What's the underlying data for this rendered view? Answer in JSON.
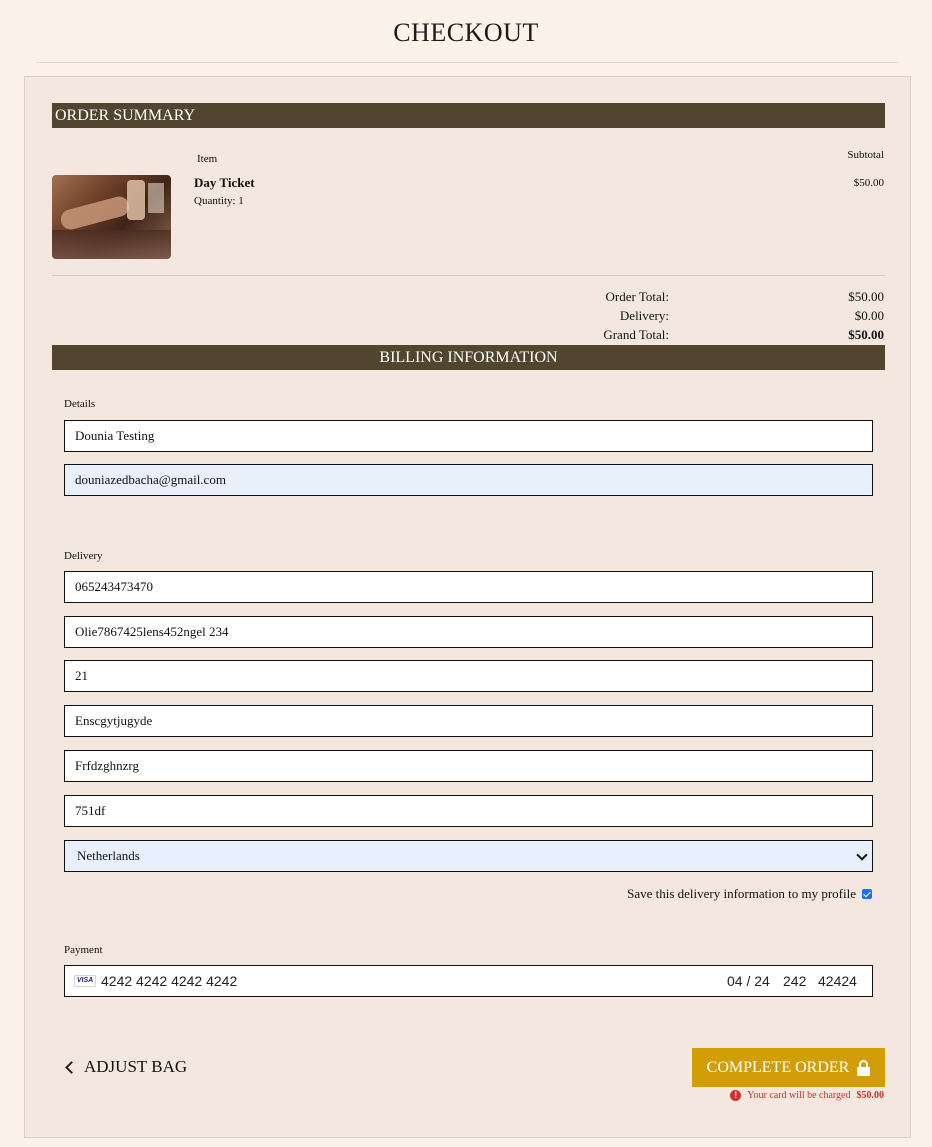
{
  "page": {
    "title": "CHECKOUT"
  },
  "order_summary": {
    "heading": "ORDER SUMMARY",
    "col_item": "Item",
    "col_subtotal": "Subtotal",
    "items": [
      {
        "name": "Day Ticket",
        "quantity": "Quantity: 1",
        "subtotal": "$50.00"
      }
    ],
    "totals": {
      "order_total_label": "Order Total:",
      "order_total": "$50.00",
      "delivery_label": "Delivery:",
      "delivery": "$0.00",
      "grand_total_label": "Grand Total:",
      "grand_total": "$50.00"
    }
  },
  "billing": {
    "heading": "BILLING INFORMATION",
    "details_label": "Details",
    "full_name": "Dounia Testing",
    "email": "douniazedbacha@gmail.com",
    "delivery_label": "Delivery",
    "phone": "065243473470",
    "street1": "Olie7867425lens452ngel 234",
    "street2": "21",
    "town": "Enscgytjugyde",
    "county": "Frfdzghnzrg",
    "postcode": "751df",
    "country": "Netherlands",
    "save_info_label": "Save this delivery information to my profile",
    "save_info_checked": true,
    "payment_label": "Payment",
    "card_brand": "VISA",
    "card_number": "4242 4242 4242 4242",
    "card_expiry": "04 / 24",
    "card_cvc": "242",
    "card_zip": "42424"
  },
  "actions": {
    "adjust_bag": "ADJUST BAG",
    "complete_order": "COMPLETE ORDER",
    "charge_notice": "Your card will be charged",
    "charge_amount": "$50.00"
  },
  "colors": {
    "background": "#fdf2ea",
    "panel": "#f3e7df",
    "band": "#52452f",
    "accent_button": "#d29e08",
    "error": "#c0392b"
  }
}
